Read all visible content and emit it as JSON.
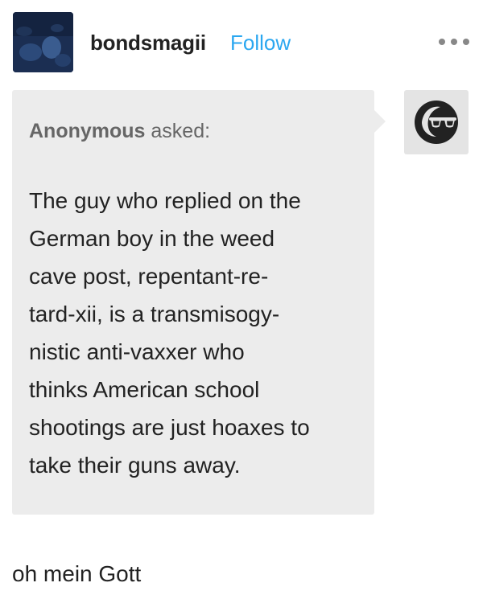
{
  "post": {
    "author": "bondsmagii",
    "follow_label": "Follow",
    "more_icon": "more-horizontal-icon",
    "ask": {
      "asker": "Anonymous",
      "asked_label": "asked:",
      "question_lines": "The guy who replied on the\nGerman boy in the weed\ncave post, repentant-re-\ntard-xii, is a transmisogy-\nnistic anti-vaxxer who\nthinks American school\nshootings are just hoaxes to\ntake their guns away.",
      "anon_avatar_icon": "anonymous-sunglasses-icon"
    },
    "answer": "oh mein Gott"
  },
  "colors": {
    "follow": "#2ba7f0",
    "bubble": "#ececec",
    "text": "#222222",
    "muted": "#666666"
  }
}
